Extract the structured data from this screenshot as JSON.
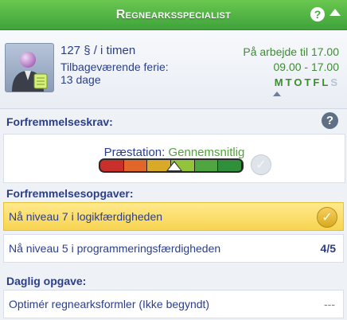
{
  "header": {
    "title": "Regnearksspecialist",
    "help_glyph": "?",
    "accent": "#4aa842"
  },
  "info": {
    "wage": "127 § / i timen",
    "vacation_label": "Tilbageværende ferie:",
    "vacation_days": "13 dage",
    "work_label": "På arbejde til 17.00",
    "work_hours": "09.00 - 17.00",
    "days": [
      {
        "letter": "M",
        "active": true
      },
      {
        "letter": "T",
        "active": true
      },
      {
        "letter": "O",
        "active": true
      },
      {
        "letter": "T",
        "active": true
      },
      {
        "letter": "F",
        "active": true
      },
      {
        "letter": "L",
        "active": true
      },
      {
        "letter": "S",
        "active": false
      }
    ],
    "current_day_index": 2
  },
  "promotion_requirements": {
    "title": "Forfremmelseskrav:",
    "help_glyph": "?",
    "performance_prefix": "Præstation:",
    "performance_value": "Gennemsnitlig",
    "performance_level": 0.5,
    "meter_colors": [
      "#c9302c",
      "#e0662a",
      "#d9a928",
      "#93c23b",
      "#4fa640",
      "#2f8f3a"
    ]
  },
  "promotion_tasks": {
    "title": "Forfremmelsesopgaver:",
    "items": [
      {
        "label": "Nå niveau 7 i logikfærdigheden",
        "status": "completed"
      },
      {
        "label": "Nå niveau 5 i programmeringsfærdigheden",
        "progress": "4/5"
      }
    ]
  },
  "daily_task": {
    "title": "Daglig opgave:",
    "label": "Optimér regnearksformler (Ikke begyndt)",
    "status": "---"
  }
}
